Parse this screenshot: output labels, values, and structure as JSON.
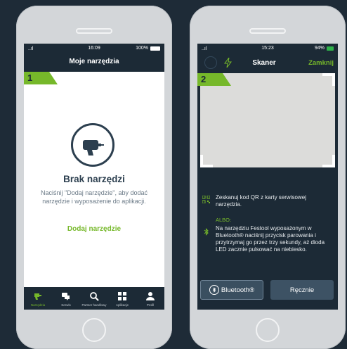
{
  "screen1": {
    "status": {
      "signal": "..ıl",
      "time": "16:09",
      "battery": "100%"
    },
    "title": "Moje narzędzia",
    "step": "1",
    "empty_title": "Brak narzędzi",
    "empty_text": "Naciśnij \"Dodaj narzędzie\", aby dodać narzędzie i wyposażenie do aplikacji.",
    "add_link": "Dodaj narzędzie",
    "tabs": [
      {
        "label": "Narzędzia",
        "icon": "drill-icon",
        "active": true
      },
      {
        "label": "Serwis",
        "icon": "chat-icon",
        "active": false
      },
      {
        "label": "Partner handlowy",
        "icon": "search-icon",
        "active": false
      },
      {
        "label": "Aplikacje",
        "icon": "grid-icon",
        "active": false
      },
      {
        "label": "Profil",
        "icon": "user-icon",
        "active": false
      }
    ]
  },
  "screen2": {
    "status": {
      "signal": "..ıl",
      "time": "15:23",
      "battery": "94%"
    },
    "title": "Skaner",
    "close": "Zamknij",
    "step": "2",
    "qr_text": "Zeskanuj kod QR z karty serwisowej narzędzia.",
    "or_text": "ALBO:",
    "bt_text": "Na narzędziu Festool wyposażonym w Bluetooth® naciśnij przycisk parowania i przytrzymaj go przez trzy sekundy, aż dioda LED zacznie pulsować na niebiesko.",
    "btn_bluetooth": "Bluetooth®",
    "btn_manual": "Ręcznie"
  },
  "colors": {
    "accent": "#76b82a",
    "dark": "#1c2a36",
    "background": "#1e2b37"
  }
}
